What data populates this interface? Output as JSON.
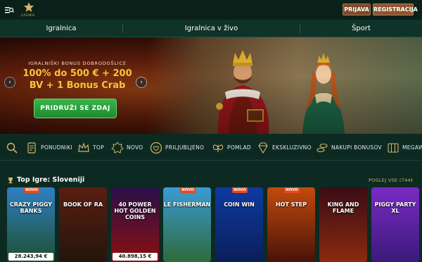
{
  "header": {
    "logo_text": "CASINIA",
    "login_label": "PRIJAVA",
    "register_label": "REGISTRACIJA"
  },
  "nav": {
    "tabs": [
      {
        "label": "Igralnica"
      },
      {
        "label": "Igralnica v živo"
      },
      {
        "label": "Šport"
      }
    ]
  },
  "hero": {
    "eyebrow": "IGRALNIŠKI BONUS DOBRODOŠLICE",
    "line1": "100% do 500 € + 200",
    "line2": "BV + 1 Bonus Crab",
    "cta_label": "PRIDRUŽI SE ZDAJ",
    "prev_icon": "‹",
    "next_icon": "›",
    "slide_index": 1,
    "slide_count": 4
  },
  "categories": [
    {
      "label": "",
      "icon": "search-icon"
    },
    {
      "label": "PONUDNIKI",
      "icon": "scroll-icon"
    },
    {
      "label": "TOP",
      "icon": "crown-icon"
    },
    {
      "label": "NOVO",
      "icon": "new-badge-icon"
    },
    {
      "label": "PRILJUBLJENO",
      "icon": "heart-icon"
    },
    {
      "label": "POMLAD",
      "icon": "butterfly-icon"
    },
    {
      "label": "EKSKLUZIVNO",
      "icon": "diamond-icon"
    },
    {
      "label": "NAKUPI BONUSOV",
      "icon": "coins-icon"
    },
    {
      "label": "MEGAWA",
      "icon": "slot-icon"
    }
  ],
  "games_section": {
    "title": "Top Igre: Sloveniji",
    "see_all_label": "POGLEJ VSE (744)",
    "see_all_arrow": "›",
    "games": [
      {
        "title": "CRAZY PIGGY BANKS",
        "badge": "NOVO",
        "amount": "28.243,94 €",
        "color_top": "#2f7fc4",
        "color_bottom": "#1e4f2e"
      },
      {
        "title": "BOOK OF RA",
        "badge": "",
        "amount": "",
        "color_top": "#5a1e10",
        "color_bottom": "#24150c"
      },
      {
        "title": "40 POWER HOT GOLDEN COINS",
        "badge": "",
        "amount": "40.898,15 €",
        "color_top": "#2a0f4a",
        "color_bottom": "#8a1010"
      },
      {
        "title": "LE FISHERMAN",
        "badge": "NOVO",
        "amount": "",
        "color_top": "#3a9bd4",
        "color_bottom": "#2e6a3a"
      },
      {
        "title": "COIN WIN",
        "badge": "NOVO",
        "amount": "",
        "color_top": "#0e3aa0",
        "color_bottom": "#0a1f5a"
      },
      {
        "title": "HOT STEP",
        "badge": "NOVO",
        "amount": "",
        "color_top": "#c24a0e",
        "color_bottom": "#4a1208"
      },
      {
        "title": "KING AND FLAME",
        "badge": "",
        "amount": "",
        "color_top": "#3a0c14",
        "color_bottom": "#8a2a10"
      },
      {
        "title": "PIGGY PARTY XL",
        "badge": "",
        "amount": "",
        "color_top": "#7a2ac4",
        "color_bottom": "#3a1a7a"
      }
    ]
  }
}
